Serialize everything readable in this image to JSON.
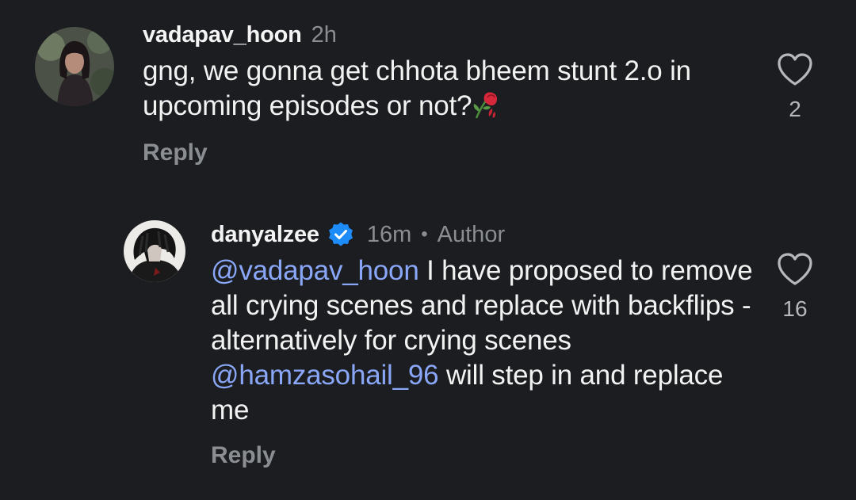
{
  "comments": [
    {
      "username": "vadapav_hoon",
      "time": "2h",
      "text": "gng, we gonna get chhota bheem stunt 2.o in upcoming episodes or not?",
      "emoji_icon": "wilted-rose-icon",
      "reply_label": "Reply",
      "likes": "2"
    },
    {
      "username": "danyalzee",
      "verified": true,
      "time": "16m",
      "separator": "•",
      "author_tag": "Author",
      "mention_1": "@vadapav_hoon",
      "text_part_1": " I have proposed to remove all crying scenes and replace with backflips - alternatively for crying scenes ",
      "mention_2": "@hamzasohail_96",
      "text_part_2": " will step in and replace me",
      "reply_label": "Reply",
      "likes": "16"
    }
  ],
  "colors": {
    "background": "#1b1d20",
    "mention": "#8aa6f7",
    "muted": "#8a8d91",
    "verified": "#1d8cf8",
    "rose": "#d6283a"
  }
}
